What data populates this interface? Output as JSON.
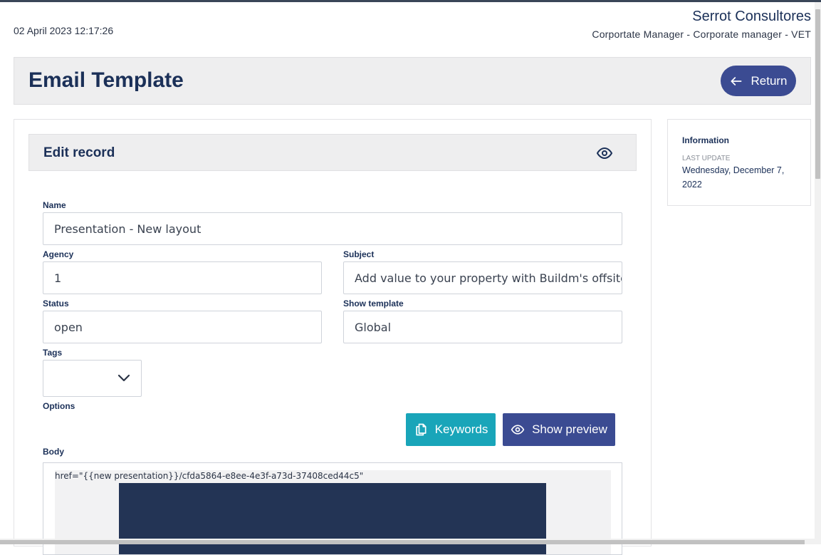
{
  "header": {
    "datetime": "02 April 2023 12:17:26",
    "company": "Serrot Consultores",
    "role": "Corportate Manager - Corporate manager - VET"
  },
  "page": {
    "title": "Email Template",
    "return_label": "Return"
  },
  "form": {
    "section_title": "Edit record",
    "name": {
      "label": "Name",
      "value": "Presentation - New layout"
    },
    "agency": {
      "label": "Agency",
      "value": "1"
    },
    "subject": {
      "label": "Subject",
      "value": "Add value to your property with Buildm's offsite"
    },
    "status": {
      "label": "Status",
      "value": "open"
    },
    "show_template": {
      "label": "Show template",
      "value": "Global"
    },
    "tags": {
      "label": "Tags",
      "value": ""
    },
    "options": {
      "label": "Options"
    },
    "keywords_label": "Keywords",
    "preview_label": "Show preview",
    "body": {
      "label": "Body",
      "code": "href=\"{{new presentation}}/cfda5864-e8ee-4e3f-a73d-37408ced44c5\""
    }
  },
  "info": {
    "title": "Information",
    "last_update_label": "LAST UPDATE",
    "last_update_value": "Wednesday, December 7, 2022"
  },
  "colors": {
    "primary": "#3b4b92",
    "teal": "#19a5b9",
    "navy_text": "#1b3058",
    "panel_bg": "#eeeeef"
  }
}
